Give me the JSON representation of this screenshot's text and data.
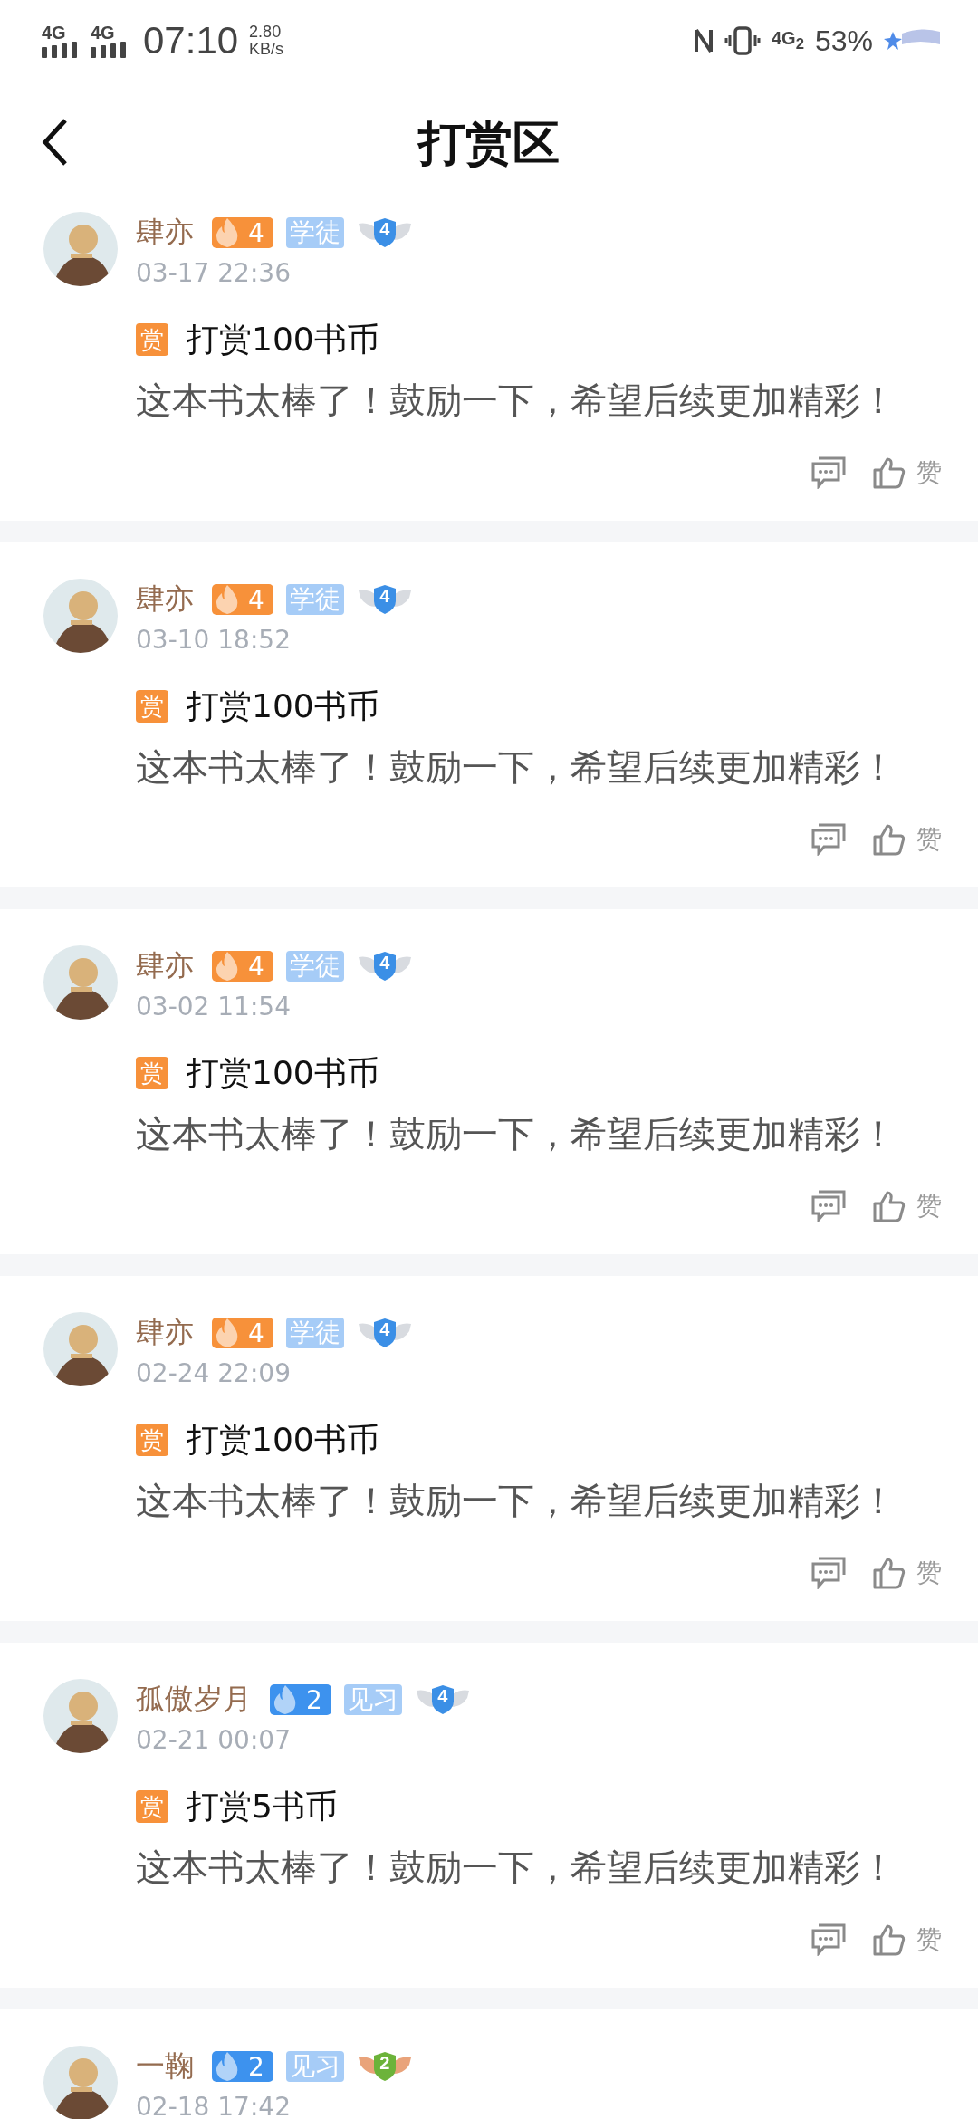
{
  "status_bar": {
    "signals": [
      "4G",
      "4G"
    ],
    "time": "07:10",
    "net_speed": "2.80",
    "net_unit": "KB/s",
    "network": "4G$_{2}$",
    "battery": "53%"
  },
  "header": {
    "title": "打赏区"
  },
  "posts": [
    {
      "name": "肆亦",
      "level": "4",
      "color": "#f7913a",
      "rank": "学徒",
      "medal": "4",
      "kind": "silver",
      "time": "03-17 22:36",
      "reward_tag": "赏",
      "reward": "打赏100书币",
      "message": "这本书太棒了！鼓励一下，希望后续更加精彩！",
      "like_label": "赞"
    },
    {
      "name": "肆亦",
      "level": "4",
      "color": "#f7913a",
      "rank": "学徒",
      "medal": "4",
      "kind": "silver",
      "time": "03-10 18:52",
      "reward_tag": "赏",
      "reward": "打赏100书币",
      "message": "这本书太棒了！鼓励一下，希望后续更加精彩！",
      "like_label": "赞"
    },
    {
      "name": "肆亦",
      "level": "4",
      "color": "#f7913a",
      "rank": "学徒",
      "medal": "4",
      "kind": "silver",
      "time": "03-02 11:54",
      "reward_tag": "赏",
      "reward": "打赏100书币",
      "message": "这本书太棒了！鼓励一下，希望后续更加精彩！",
      "like_label": "赞"
    },
    {
      "name": "肆亦",
      "level": "4",
      "color": "#f7913a",
      "rank": "学徒",
      "medal": "4",
      "kind": "silver",
      "time": "02-24 22:09",
      "reward_tag": "赏",
      "reward": "打赏100书币",
      "message": "这本书太棒了！鼓励一下，希望后续更加精彩！",
      "like_label": "赞"
    },
    {
      "name": "孤傲岁月",
      "level": "2",
      "color": "#3d92ee",
      "rank": "见习",
      "medal": "4",
      "kind": "silver",
      "time": "02-21 00:07",
      "reward_tag": "赏",
      "reward": "打赏5书币",
      "message": "这本书太棒了！鼓励一下，希望后续更加精彩！",
      "like_label": "赞"
    },
    {
      "name": "一鞠",
      "level": "2",
      "color": "#3d92ee",
      "rank": "见习",
      "medal": "2",
      "kind": "bronze",
      "time": "02-18 17:42"
    }
  ]
}
